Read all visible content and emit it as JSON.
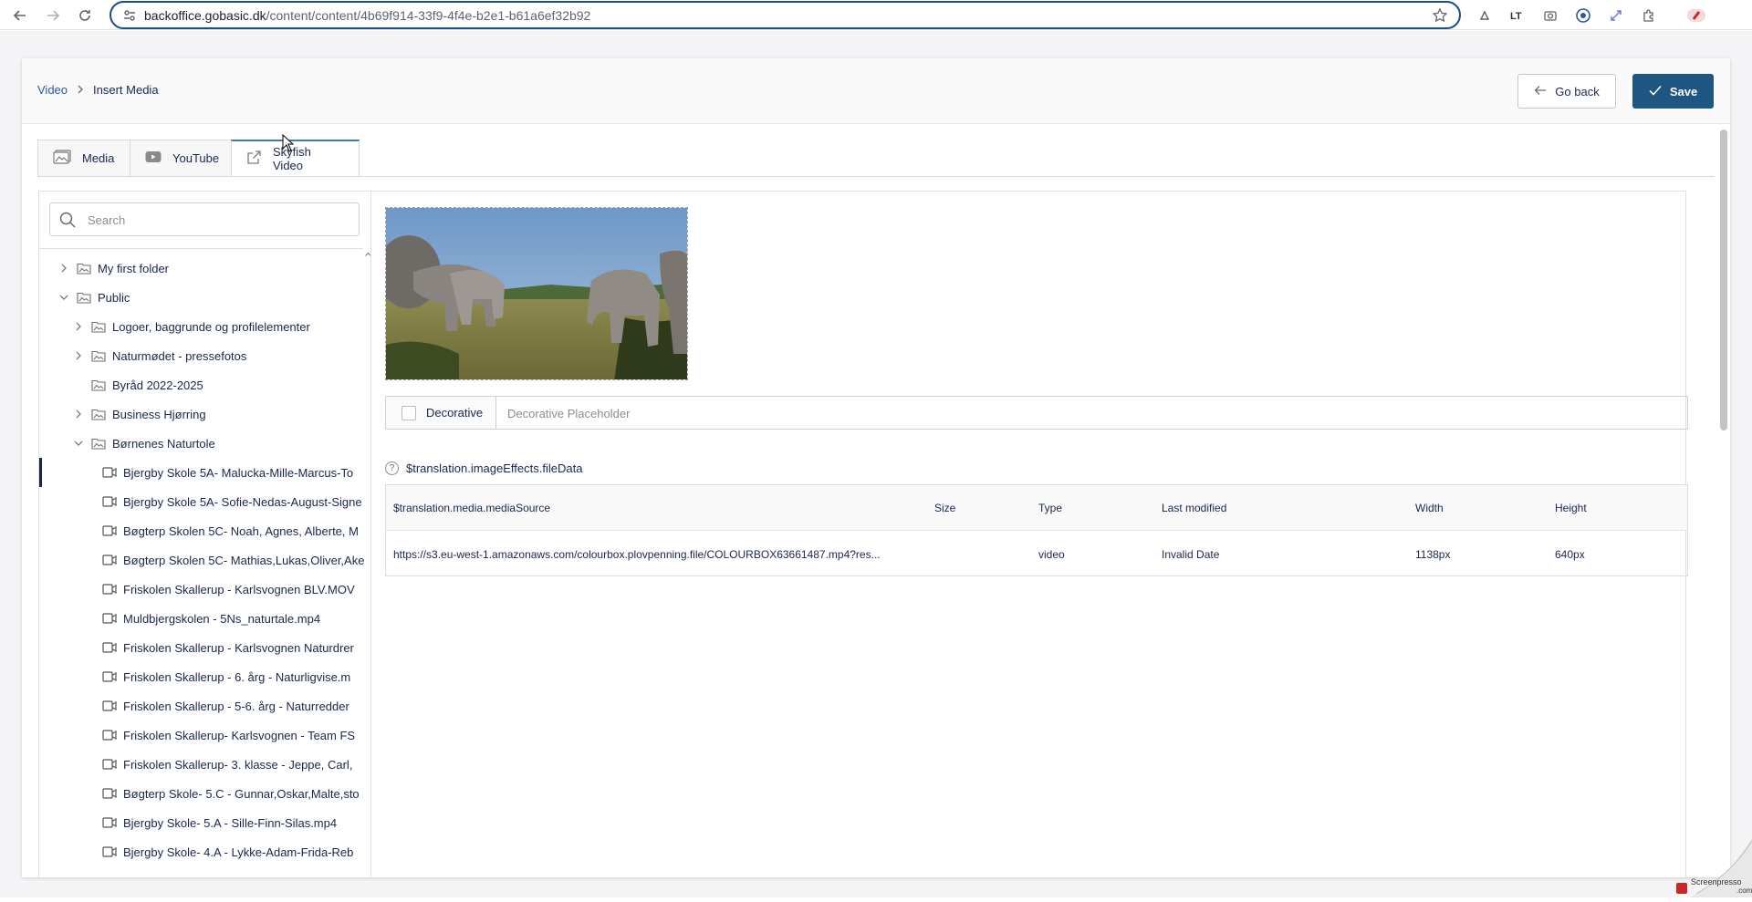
{
  "browser": {
    "url_host": "backoffice.gobasic.dk",
    "url_path": "/content/content/4b69f914-33f9-4f4e-b2e1-b61a6ef32b92"
  },
  "breadcrumb": {
    "parent": "Video",
    "current": "Insert Media"
  },
  "actions": {
    "go_back": "Go back",
    "save": "Save"
  },
  "tabs": [
    {
      "label": "Media",
      "icon": "media-icon"
    },
    {
      "label": "YouTube",
      "icon": "youtube-icon"
    },
    {
      "label": "Skyfish Video",
      "icon": "external-link-icon"
    }
  ],
  "search": {
    "placeholder": "Search"
  },
  "tree": [
    {
      "label": "My first folder",
      "level": 1,
      "chevron": "right",
      "type": "folder"
    },
    {
      "label": "Public",
      "level": 1,
      "chevron": "down",
      "type": "folder"
    },
    {
      "label": "Logoer, baggrunde og profilelementer",
      "level": 2,
      "chevron": "right",
      "type": "folder"
    },
    {
      "label": "Naturmødet - pressefotos",
      "level": 2,
      "chevron": "right",
      "type": "folder"
    },
    {
      "label": "Byråd 2022-2025",
      "level": 2,
      "chevron": "none",
      "type": "folder"
    },
    {
      "label": "Business Hjørring",
      "level": 2,
      "chevron": "right",
      "type": "folder"
    },
    {
      "label": "Børnenes Naturtole",
      "level": 2,
      "chevron": "down",
      "type": "folder"
    },
    {
      "label": "Bjergby Skole 5A- Malucka-Mille-Marcus-To",
      "level": 3,
      "chevron": "none",
      "type": "video",
      "selected": true
    },
    {
      "label": "Bjergby Skole 5A- Sofie-Nedas-August-Signe",
      "level": 3,
      "chevron": "none",
      "type": "video"
    },
    {
      "label": "Bøgterp Skolen 5C- Noah, Agnes, Alberte, M",
      "level": 3,
      "chevron": "none",
      "type": "video"
    },
    {
      "label": "Bøgterp Skolen 5C- Mathias,Lukas,Oliver,Ake",
      "level": 3,
      "chevron": "none",
      "type": "video"
    },
    {
      "label": "Friskolen Skallerup - Karlsvognen BLV.MOV",
      "level": 3,
      "chevron": "none",
      "type": "video"
    },
    {
      "label": "Muldbjergskolen - 5Ns_naturtale.mp4",
      "level": 3,
      "chevron": "none",
      "type": "video"
    },
    {
      "label": "Friskolen Skallerup - Karlsvognen Naturdrer",
      "level": 3,
      "chevron": "none",
      "type": "video"
    },
    {
      "label": "Friskolen Skallerup - 6. årg - Naturligvise.m",
      "level": 3,
      "chevron": "none",
      "type": "video"
    },
    {
      "label": "Friskolen Skallerup - 5-6. årg - Naturredder",
      "level": 3,
      "chevron": "none",
      "type": "video"
    },
    {
      "label": "Friskolen Skallerup- Karlsvognen - Team FS",
      "level": 3,
      "chevron": "none",
      "type": "video"
    },
    {
      "label": "Friskolen Skallerup- 3. klasse - Jeppe, Carl,",
      "level": 3,
      "chevron": "none",
      "type": "video"
    },
    {
      "label": "Bøgterp Skole- 5.C - Gunnar,Oskar,Malte,sto",
      "level": 3,
      "chevron": "none",
      "type": "video"
    },
    {
      "label": "Bjergby Skole- 5.A - Sille-Finn-Silas.mp4",
      "level": 3,
      "chevron": "none",
      "type": "video"
    },
    {
      "label": "Bjergby Skole- 4.A - Lykke-Adam-Frida-Reb",
      "level": 3,
      "chevron": "none",
      "type": "video"
    }
  ],
  "decorative": {
    "label": "Decorative",
    "placeholder": "Decorative Placeholder",
    "checked": false
  },
  "file_data": {
    "label": "$translation.imageEffects.fileData",
    "headers": [
      "$translation.media.mediaSource",
      "Size",
      "Type",
      "Last modified",
      "Width",
      "Height"
    ],
    "row": [
      "https://s3.eu-west-1.amazonaws.com/colourbox.plovpenning.file/COLOURBOX63661487.mp4?res...",
      "",
      "video",
      "Invalid Date",
      "1138px",
      "640px"
    ]
  },
  "colors": {
    "accent": "#1d5680",
    "text": "#1b264f",
    "link": "#2c5aa0",
    "tab_active_border": "#3d7ea8"
  }
}
